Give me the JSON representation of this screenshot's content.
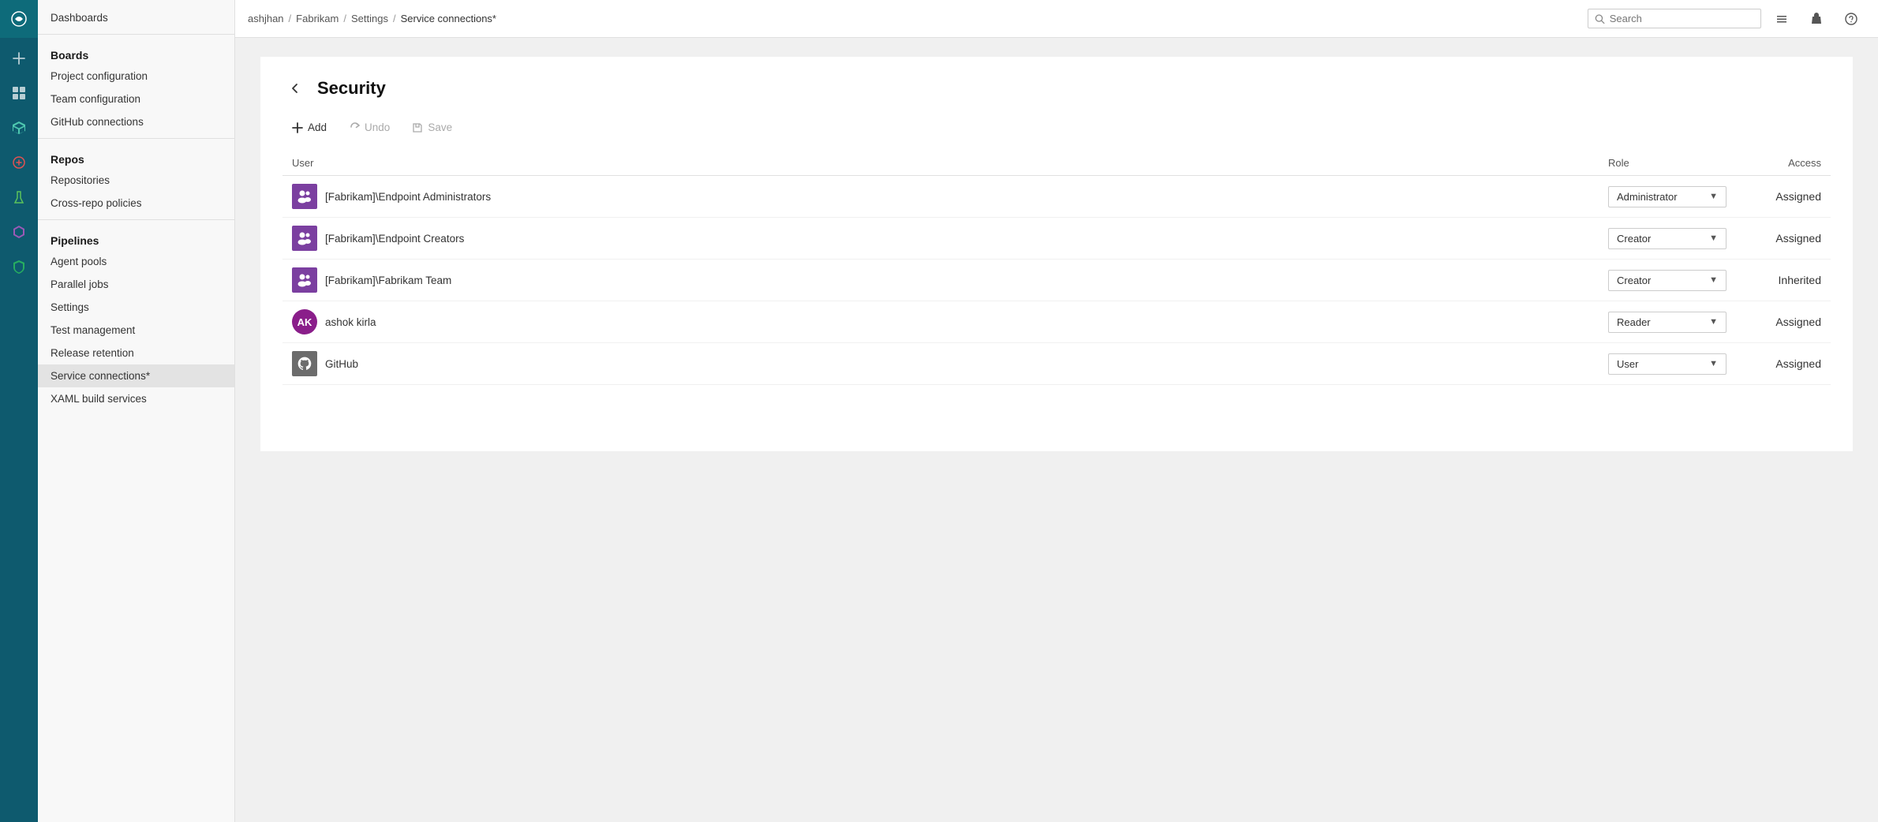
{
  "rail": {
    "logo": "F",
    "icons": [
      "☰",
      "+",
      "⊞",
      "✓",
      "📋",
      "🔧",
      "🧪",
      "⚡",
      "🚀",
      "🛡"
    ]
  },
  "breadcrumb": {
    "items": [
      "ashjhan",
      "Fabrikam",
      "Settings",
      "Service connections*"
    ]
  },
  "search": {
    "placeholder": "Search"
  },
  "sidebar": {
    "dashboards_label": "Dashboards",
    "sections": [
      {
        "title": "Boards",
        "items": [
          "Project configuration",
          "Team configuration",
          "GitHub connections"
        ]
      },
      {
        "title": "Repos",
        "items": [
          "Repositories",
          "Cross-repo policies"
        ]
      },
      {
        "title": "Pipelines",
        "items": [
          "Agent pools",
          "Parallel jobs",
          "Settings",
          "Test management",
          "Release retention",
          "Service connections*",
          "XAML build services"
        ]
      }
    ]
  },
  "page": {
    "title": "Security",
    "back_label": "←"
  },
  "toolbar": {
    "add_label": "Add",
    "undo_label": "Undo",
    "save_label": "Save"
  },
  "table": {
    "headers": {
      "user": "User",
      "role": "Role",
      "access": "Access"
    },
    "rows": [
      {
        "id": "endpoint-admins",
        "name": "[Fabrikam]\\Endpoint Administrators",
        "avatar_type": "group",
        "role": "Administrator",
        "access": "Assigned"
      },
      {
        "id": "endpoint-creators",
        "name": "[Fabrikam]\\Endpoint Creators",
        "avatar_type": "group",
        "role": "Creator",
        "access": "Assigned"
      },
      {
        "id": "fabrikam-team",
        "name": "[Fabrikam]\\Fabrikam Team",
        "avatar_type": "group",
        "role": "Creator",
        "access": "Inherited"
      },
      {
        "id": "ashok-kirla",
        "name": "ashok kirla",
        "avatar_type": "initials",
        "initials": "AK",
        "role": "Reader",
        "access": "Assigned"
      },
      {
        "id": "github",
        "name": "GitHub",
        "avatar_type": "github",
        "role": "User",
        "access": "Assigned"
      }
    ]
  }
}
